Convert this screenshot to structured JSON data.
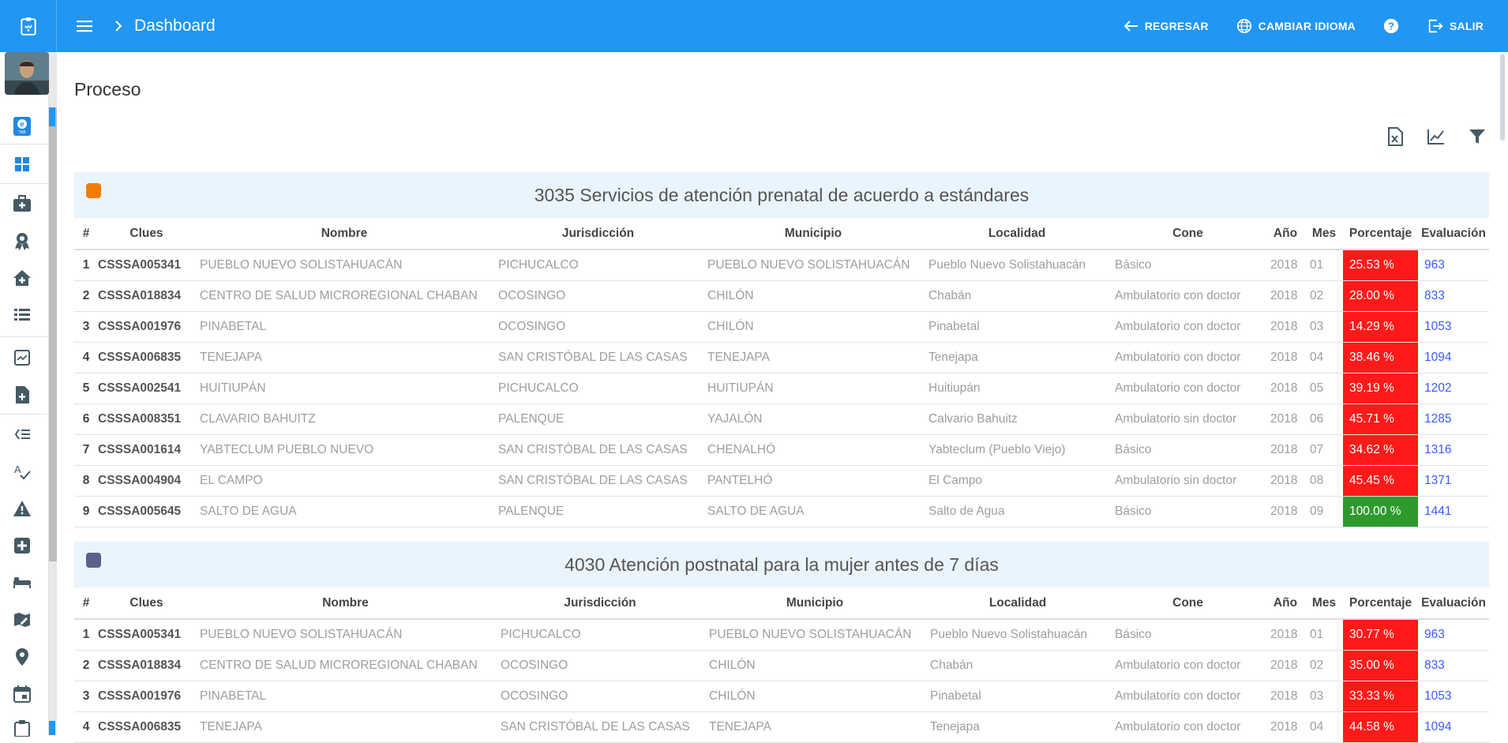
{
  "header": {
    "title": "Dashboard",
    "actions": [
      {
        "label": "REGRESAR",
        "icon": "arrow-left-icon"
      },
      {
        "label": "CAMBIAR IDIOMA",
        "icon": "globe-icon"
      },
      {
        "label": "",
        "icon": "help-icon"
      },
      {
        "label": "SALIR",
        "icon": "exit-icon"
      }
    ]
  },
  "sidebar": {
    "icons": [
      "etab-icon",
      "dashboard-icon",
      "medical-kit-icon",
      "award-icon",
      "home-health-icon",
      "list-icon",
      "add-document-icon",
      "add-file-icon",
      "checklist-icon",
      "spellcheck-icon",
      "warning-icon",
      "hospital-plus-icon",
      "bed-icon",
      "map-edit-icon",
      "location-icon",
      "calendar-icon"
    ]
  },
  "page": {
    "title": "Proceso"
  },
  "columns": [
    "#",
    "Clues",
    "Nombre",
    "Jurisdicción",
    "Municipio",
    "Localidad",
    "Cone",
    "Año",
    "Mes",
    "Porcentaje",
    "Evaluación"
  ],
  "sections": [
    {
      "title": "3035 Servicios de atención prenatal de acuerdo a estándares",
      "color": "#f57c00",
      "rows": [
        {
          "n": "1",
          "clues": "CSSSA005341",
          "nombre": "PUEBLO NUEVO SOLISTAHUACÁN",
          "juris": "PICHUCALCO",
          "muni": "PUEBLO NUEVO SOLISTAHUACÁN",
          "loc": "Pueblo Nuevo Solistahuacán",
          "cone": "Básico",
          "anio": "2018",
          "mes": "01",
          "pct": "25.53 %",
          "ok": false,
          "eval": "963"
        },
        {
          "n": "2",
          "clues": "CSSSA018834",
          "nombre": "CENTRO DE SALUD MICROREGIONAL CHABAN",
          "juris": "OCOSINGO",
          "muni": "CHILÓN",
          "loc": "Chabán",
          "cone": "Ambulatorio con doctor",
          "anio": "2018",
          "mes": "02",
          "pct": "28.00 %",
          "ok": false,
          "eval": "833"
        },
        {
          "n": "3",
          "clues": "CSSSA001976",
          "nombre": "PINABETAL",
          "juris": "OCOSINGO",
          "muni": "CHILÓN",
          "loc": "Pinabetal",
          "cone": "Ambulatorio con doctor",
          "anio": "2018",
          "mes": "03",
          "pct": "14.29 %",
          "ok": false,
          "eval": "1053"
        },
        {
          "n": "4",
          "clues": "CSSSA006835",
          "nombre": "TENEJAPA",
          "juris": "SAN CRISTÓBAL DE LAS CASAS",
          "muni": "TENEJAPA",
          "loc": "Tenejapa",
          "cone": "Ambulatorio con doctor",
          "anio": "2018",
          "mes": "04",
          "pct": "38.46 %",
          "ok": false,
          "eval": "1094"
        },
        {
          "n": "5",
          "clues": "CSSSA002541",
          "nombre": "HUITIUPÁN",
          "juris": "PICHUCALCO",
          "muni": "HUITIUPÁN",
          "loc": "Huitiupán",
          "cone": "Ambulatorio con doctor",
          "anio": "2018",
          "mes": "05",
          "pct": "39.19 %",
          "ok": false,
          "eval": "1202"
        },
        {
          "n": "6",
          "clues": "CSSSA008351",
          "nombre": "CLAVARIO BAHUITZ",
          "juris": "PALENQUE",
          "muni": "YAJALÓN",
          "loc": "Calvario Bahuitz",
          "cone": "Ambulatorio sin doctor",
          "anio": "2018",
          "mes": "06",
          "pct": "45.71 %",
          "ok": false,
          "eval": "1285"
        },
        {
          "n": "7",
          "clues": "CSSSA001614",
          "nombre": "YABTECLUM PUEBLO NUEVO",
          "juris": "SAN CRISTÓBAL DE LAS CASAS",
          "muni": "CHENALHÓ",
          "loc": "Yabteclum (Pueblo Viejo)",
          "cone": "Básico",
          "anio": "2018",
          "mes": "07",
          "pct": "34.62 %",
          "ok": false,
          "eval": "1316"
        },
        {
          "n": "8",
          "clues": "CSSSA004904",
          "nombre": "EL CAMPO",
          "juris": "SAN CRISTÓBAL DE LAS CASAS",
          "muni": "PANTELHÓ",
          "loc": "El Campo",
          "cone": "Ambulatorio sin doctor",
          "anio": "2018",
          "mes": "08",
          "pct": "45.45 %",
          "ok": false,
          "eval": "1371"
        },
        {
          "n": "9",
          "clues": "CSSSA005645",
          "nombre": "SALTO DE AGUA",
          "juris": "PALENQUE",
          "muni": "SALTO DE AGUA",
          "loc": "Salto de Agua",
          "cone": "Básico",
          "anio": "2018",
          "mes": "09",
          "pct": "100.00 %",
          "ok": true,
          "eval": "1441"
        }
      ]
    },
    {
      "title": "4030 Atención postnatal para la mujer antes de 7 días",
      "color": "#5c5f8a",
      "rows": [
        {
          "n": "1",
          "clues": "CSSSA005341",
          "nombre": "PUEBLO NUEVO SOLISTAHUACÁN",
          "juris": "PICHUCALCO",
          "muni": "PUEBLO NUEVO SOLISTAHUACÁN",
          "loc": "Pueblo Nuevo Solistahuacán",
          "cone": "Básico",
          "anio": "2018",
          "mes": "01",
          "pct": "30.77 %",
          "ok": false,
          "eval": "963"
        },
        {
          "n": "2",
          "clues": "CSSSA018834",
          "nombre": "CENTRO DE SALUD MICROREGIONAL CHABAN",
          "juris": "OCOSINGO",
          "muni": "CHILÓN",
          "loc": "Chabán",
          "cone": "Ambulatorio con doctor",
          "anio": "2018",
          "mes": "02",
          "pct": "35.00 %",
          "ok": false,
          "eval": "833"
        },
        {
          "n": "3",
          "clues": "CSSSA001976",
          "nombre": "PINABETAL",
          "juris": "OCOSINGO",
          "muni": "CHILÓN",
          "loc": "Pinabetal",
          "cone": "Ambulatorio con doctor",
          "anio": "2018",
          "mes": "03",
          "pct": "33.33 %",
          "ok": false,
          "eval": "1053"
        },
        {
          "n": "4",
          "clues": "CSSSA006835",
          "nombre": "TENEJAPA",
          "juris": "SAN CRISTÓBAL DE LAS CASAS",
          "muni": "TENEJAPA",
          "loc": "Tenejapa",
          "cone": "Ambulatorio con doctor",
          "anio": "2018",
          "mes": "04",
          "pct": "44.58 %",
          "ok": false,
          "eval": "1094"
        }
      ]
    }
  ]
}
